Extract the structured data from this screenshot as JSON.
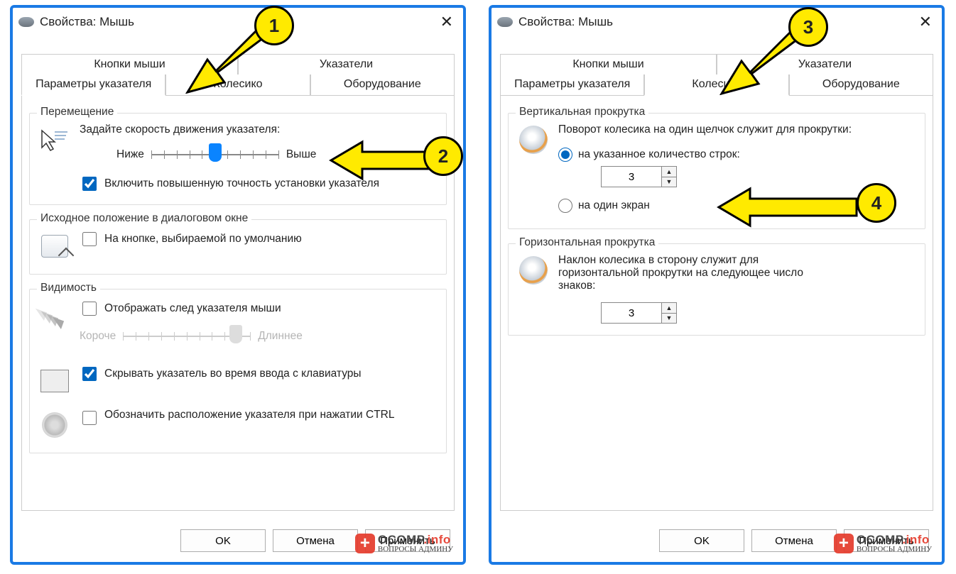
{
  "title": "Свойства: Мышь",
  "tabs": {
    "buttons": "Кнопки мыши",
    "pointers": "Указатели",
    "pointer_options": "Параметры указателя",
    "wheel": "Колесико",
    "hardware": "Оборудование"
  },
  "left": {
    "active_tab": "pointer_options",
    "motion": {
      "title": "Перемещение",
      "speed_label": "Задайте скорость движения указателя:",
      "slow": "Ниже",
      "fast": "Выше",
      "enhance": "Включить повышенную точность установки указателя",
      "enhance_checked": true
    },
    "snap": {
      "title": "Исходное положение в диалоговом окне",
      "label": "На кнопке, выбираемой по умолчанию",
      "checked": false
    },
    "visibility": {
      "title": "Видимость",
      "trails": "Отображать след указателя мыши",
      "trails_checked": false,
      "short": "Короче",
      "long": "Длиннее",
      "hide": "Скрывать указатель во время ввода с клавиатуры",
      "hide_checked": true,
      "ctrl": "Обозначить расположение указателя при нажатии CTRL",
      "ctrl_checked": false
    }
  },
  "right": {
    "active_tab": "wheel",
    "vscroll": {
      "title": "Вертикальная прокрутка",
      "desc": "Поворот колесика на один щелчок служит для прокрутки:",
      "opt_lines": "на указанное количество строк:",
      "lines_value": "3",
      "opt_screen": "на один экран",
      "selected": "lines"
    },
    "hscroll": {
      "title": "Горизонтальная прокрутка",
      "desc": "Наклон колесика в сторону служит для горизонтальной прокрутки на следующее число знаков:",
      "value": "3"
    }
  },
  "buttons": {
    "ok": "OK",
    "cancel": "Отмена",
    "apply": "Применить"
  },
  "callouts": {
    "1": "1",
    "2": "2",
    "3": "3",
    "4": "4"
  },
  "watermark": {
    "brand": "OCOMP",
    "tld": ".info",
    "sub": "ВОПРОСЫ АДМИНУ"
  }
}
